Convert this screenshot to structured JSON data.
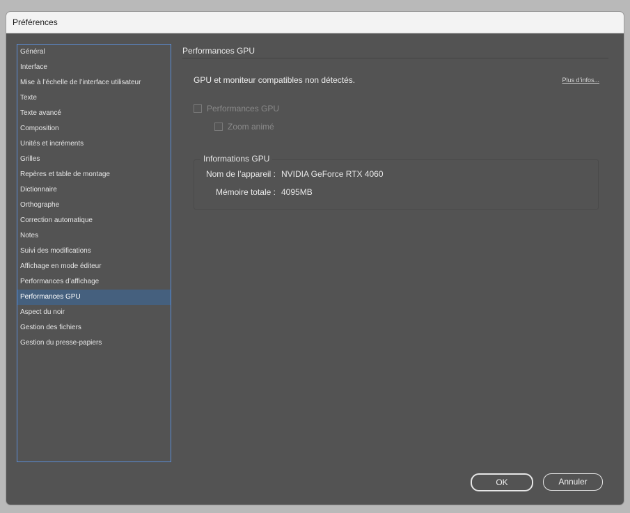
{
  "window": {
    "title": "Préférences"
  },
  "sidebar": {
    "items": [
      {
        "label": "Général"
      },
      {
        "label": "Interface"
      },
      {
        "label": "Mise à l’échelle de l’interface utilisateur"
      },
      {
        "label": "Texte"
      },
      {
        "label": "Texte avancé"
      },
      {
        "label": "Composition"
      },
      {
        "label": "Unités et incréments"
      },
      {
        "label": "Grilles"
      },
      {
        "label": "Repères et table de montage"
      },
      {
        "label": "Dictionnaire"
      },
      {
        "label": "Orthographe"
      },
      {
        "label": "Correction automatique"
      },
      {
        "label": "Notes"
      },
      {
        "label": "Suivi des modifications"
      },
      {
        "label": "Affichage en mode éditeur"
      },
      {
        "label": "Performances d’affichage"
      },
      {
        "label": "Performances GPU",
        "selected": true
      },
      {
        "label": "Aspect du noir"
      },
      {
        "label": "Gestion des fichiers"
      },
      {
        "label": "Gestion du presse-papiers"
      }
    ]
  },
  "main": {
    "section_title": "Performances GPU",
    "status_text": "GPU et moniteur compatibles non détectés.",
    "more_info_link": "Plus d’infos...",
    "checkboxes": {
      "gpu_performance": {
        "label": "Performances GPU",
        "checked": false,
        "enabled": false
      },
      "animated_zoom": {
        "label": "Zoom animé",
        "checked": false,
        "enabled": false
      }
    },
    "gpu_info": {
      "legend": "Informations GPU",
      "device_label": "Nom de l’appareil :",
      "device_value": "NVIDIA GeForce RTX 4060",
      "memory_label": "Mémoire totale :",
      "memory_value": "4095MB"
    }
  },
  "buttons": {
    "ok": "OK",
    "cancel": "Annuler"
  },
  "colors": {
    "panel_bg": "#535353",
    "selection": "#45607e",
    "sidebar_border": "#5b8ed8",
    "titlebar_bg": "#f3f3f3"
  }
}
